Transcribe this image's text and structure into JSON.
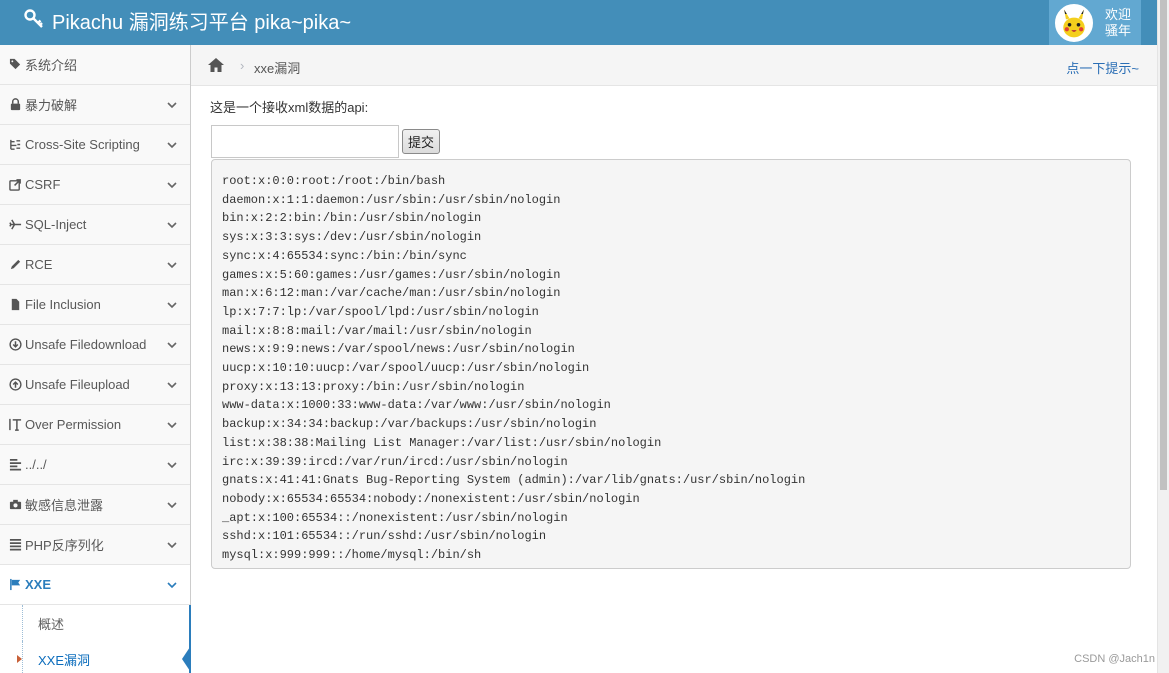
{
  "navbar": {
    "brand": "Pikachu 漏洞练习平台 pika~pika~",
    "welcome_line1": "欢迎",
    "welcome_line2": "骚年"
  },
  "sidebar": {
    "items": [
      {
        "label": "系统介绍",
        "icon": "tags-icon"
      },
      {
        "label": "暴力破解",
        "icon": "lock-icon"
      },
      {
        "label": "Cross-Site Scripting",
        "icon": "list-tree-icon"
      },
      {
        "label": "CSRF",
        "icon": "share-icon"
      },
      {
        "label": "SQL-Inject",
        "icon": "plane-icon"
      },
      {
        "label": "RCE",
        "icon": "pencil-icon"
      },
      {
        "label": "File Inclusion",
        "icon": "file-icon"
      },
      {
        "label": "Unsafe Filedownload",
        "icon": "download-circle-icon"
      },
      {
        "label": "Unsafe Fileupload",
        "icon": "upload-circle-icon"
      },
      {
        "label": "Over Permission",
        "icon": "text-height-icon"
      },
      {
        "label": "../../",
        "icon": "align-left-icon"
      },
      {
        "label": "敏感信息泄露",
        "icon": "camera-icon"
      },
      {
        "label": "PHP反序列化",
        "icon": "align-justify-icon"
      },
      {
        "label": "XXE",
        "icon": "flag-icon"
      }
    ],
    "subitems": [
      {
        "label": "概述"
      },
      {
        "label": "XXE漏洞"
      }
    ]
  },
  "breadcrumbs": {
    "sep": "›",
    "current": "xxe漏洞",
    "hint": "点一下提示~"
  },
  "main": {
    "intro": "这是一个接收xml数据的api:",
    "input_value": "",
    "submit_label": "提交",
    "result_lines": [
      "root:x:0:0:root:/root:/bin/bash",
      "daemon:x:1:1:daemon:/usr/sbin:/usr/sbin/nologin",
      "bin:x:2:2:bin:/bin:/usr/sbin/nologin",
      "sys:x:3:3:sys:/dev:/usr/sbin/nologin",
      "sync:x:4:65534:sync:/bin:/bin/sync",
      "games:x:5:60:games:/usr/games:/usr/sbin/nologin",
      "man:x:6:12:man:/var/cache/man:/usr/sbin/nologin",
      "lp:x:7:7:lp:/var/spool/lpd:/usr/sbin/nologin",
      "mail:x:8:8:mail:/var/mail:/usr/sbin/nologin",
      "news:x:9:9:news:/var/spool/news:/usr/sbin/nologin",
      "uucp:x:10:10:uucp:/var/spool/uucp:/usr/sbin/nologin",
      "proxy:x:13:13:proxy:/bin:/usr/sbin/nologin",
      "www-data:x:1000:33:www-data:/var/www:/usr/sbin/nologin",
      "backup:x:34:34:backup:/var/backups:/usr/sbin/nologin",
      "list:x:38:38:Mailing List Manager:/var/list:/usr/sbin/nologin",
      "irc:x:39:39:ircd:/var/run/ircd:/usr/sbin/nologin",
      "gnats:x:41:41:Gnats Bug-Reporting System (admin):/var/lib/gnats:/usr/sbin/nologin",
      "nobody:x:65534:65534:nobody:/nonexistent:/usr/sbin/nologin",
      "_apt:x:100:65534::/nonexistent:/usr/sbin/nologin",
      "sshd:x:101:65534::/run/sshd:/usr/sbin/nologin",
      "mysql:x:999:999::/home/mysql:/bin/sh"
    ]
  },
  "watermark": "CSDN @Jach1n",
  "colors": {
    "navbar_bg": "#438eb9",
    "user_box_bg": "#62a8d1",
    "active_blue": "#2b7dbc",
    "link_blue": "#2a6eb5",
    "caret_orange": "#c86139"
  }
}
